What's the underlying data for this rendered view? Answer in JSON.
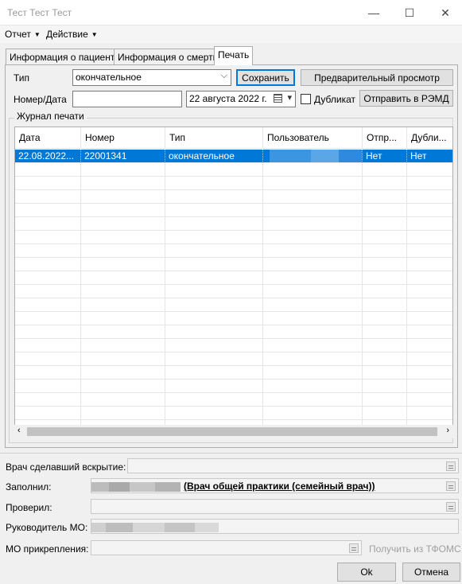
{
  "window": {
    "title": "Тест Тест Тест",
    "minimize": "—",
    "maximize": "☐",
    "close": "✕"
  },
  "menu": {
    "items": [
      "Отчет",
      "Действие"
    ]
  },
  "tabs": [
    "Информация о пациенте",
    "Информация о смерти",
    "Печать"
  ],
  "form": {
    "type_label": "Тип",
    "type_value": "окончательное",
    "save_button": "Сохранить",
    "preview_button": "Предварительный просмотр",
    "number_date_label": "Номер/Дата",
    "number_value": "",
    "date_value": "22  августа  2022 г.",
    "duplicate_label": "Дубликат",
    "send_button": "Отправить в РЭМД"
  },
  "journal": {
    "title": "Журнал печати",
    "columns": [
      "Дата",
      "Номер",
      "Тип",
      "Пользователь",
      "Отпр...",
      "Дубли..."
    ],
    "rows": [
      {
        "date": "22.08.2022...",
        "number": "22001341",
        "type": "окончательное",
        "user": "",
        "sent": "Нет",
        "dup": "Нет"
      }
    ]
  },
  "bottom": {
    "autopsy_doctor_label": "Врач сделавший вскрытие:",
    "filled_label": "Заполнил:",
    "filled_role": "(Врач общей практики (семейный врач))",
    "checked_label": "Проверил:",
    "head_label": "Руководитель МО:",
    "attachment_label": "МО прикрепления:",
    "tfoms_link": "Получить из ТФОМС"
  },
  "buttons": {
    "ok": "Ok",
    "cancel": "Отмена"
  },
  "colors": {
    "accent": "#0078d7",
    "window_bg": "#f0f0f0"
  }
}
